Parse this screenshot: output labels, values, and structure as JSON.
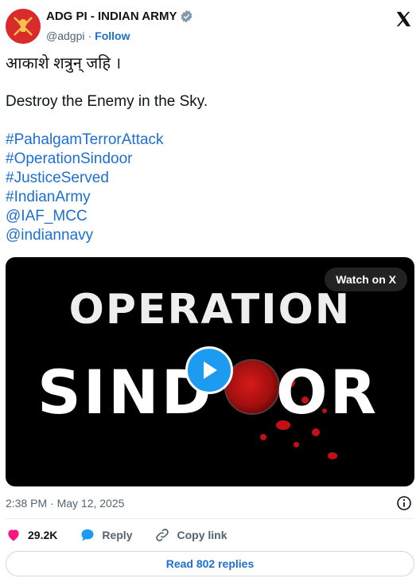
{
  "author": {
    "name": "ADG PI - INDIAN ARMY",
    "handle": "@adgpi",
    "separator": "·",
    "follow_label": "Follow"
  },
  "tweet": {
    "line_hindi": "आकाशे शत्रुन् जहि ।",
    "line_english": "Destroy the Enemy in the Sky.",
    "hashtags": [
      "#PahalgamTerrorAttack",
      "#OperationSindoor",
      "#JusticeServed",
      "#IndianArmy",
      "@IAF_MCC",
      "@indiannavy"
    ]
  },
  "media": {
    "watch_label": "Watch on X",
    "title_top": "OPERATION",
    "title_left": "SIND",
    "title_right": "OR"
  },
  "meta": {
    "timestamp": "2:38 PM · May 12, 2025"
  },
  "actions": {
    "likes": "29.2K",
    "reply_label": "Reply",
    "copy_label": "Copy link"
  },
  "read_replies_label": "Read 802 replies",
  "colors": {
    "link": "#1d6fd1",
    "heart": "#f91880",
    "play": "#1d9bf0"
  }
}
